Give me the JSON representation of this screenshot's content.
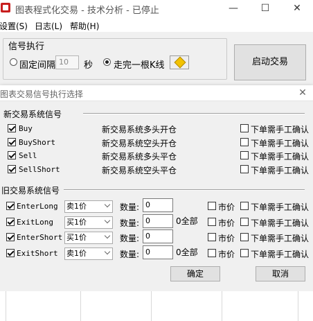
{
  "window": {
    "title": "图表程式化交易 - 技术分析 - 已停止",
    "minimize": "—",
    "maximize": "☐",
    "close": "✕"
  },
  "menubar": [
    {
      "label": "设置(S)"
    },
    {
      "label": "日志(L)"
    },
    {
      "label": "帮助(H)"
    }
  ],
  "signal_group": {
    "title": "信号执行",
    "fixed_interval": "固定间隔",
    "interval_value": "10",
    "seconds": "秒",
    "kline_label": "走完一根K线",
    "selected": "kline"
  },
  "start_button": "启动交易",
  "dialog": {
    "title": "图表交易信号执行选择",
    "close": "✕",
    "new_section": "新交易系统信号",
    "new_signals": [
      {
        "name": "Buy",
        "desc": "新交易系统多头开仓",
        "checked": true,
        "manual": "下单需手工确认",
        "manual_checked": false
      },
      {
        "name": "BuyShort",
        "desc": "新交易系统空头开仓",
        "checked": true,
        "manual": "下单需手工确认",
        "manual_checked": false
      },
      {
        "name": "Sell",
        "desc": "新交易系统多头平仓",
        "checked": true,
        "manual": "下单需手工确认",
        "manual_checked": false
      },
      {
        "name": "SellShort",
        "desc": "新交易系统空头平仓",
        "checked": true,
        "manual": "下单需手工确认",
        "manual_checked": false
      }
    ],
    "old_section": "旧交易系统信号",
    "old_signals": [
      {
        "name": "EnterLong",
        "price": "卖1价",
        "qty_label": "数量:",
        "qty": "0",
        "all": "",
        "market": "市价",
        "manual": "下单需手工确认",
        "checked": true
      },
      {
        "name": "ExitLong",
        "price": "买1价",
        "qty_label": "数量:",
        "qty": "0",
        "all": "0全部",
        "market": "市价",
        "manual": "下单需手工确认",
        "checked": true
      },
      {
        "name": "EnterShort",
        "price": "买1价",
        "qty_label": "数量:",
        "qty": "0",
        "all": "",
        "market": "市价",
        "manual": "下单需手工确认",
        "checked": true
      },
      {
        "name": "ExitShort",
        "price": "卖1价",
        "qty_label": "数量:",
        "qty": "0",
        "all": "0全部",
        "market": "市价",
        "manual": "下单需手工确认",
        "checked": true
      }
    ],
    "ok": "确定",
    "cancel": "取消"
  },
  "colors": {
    "window_bg": "#f0f0f0",
    "title_bg": "#ffffff",
    "icon_red": "#c81e1e",
    "dialog_border": "#9bb6d4"
  }
}
